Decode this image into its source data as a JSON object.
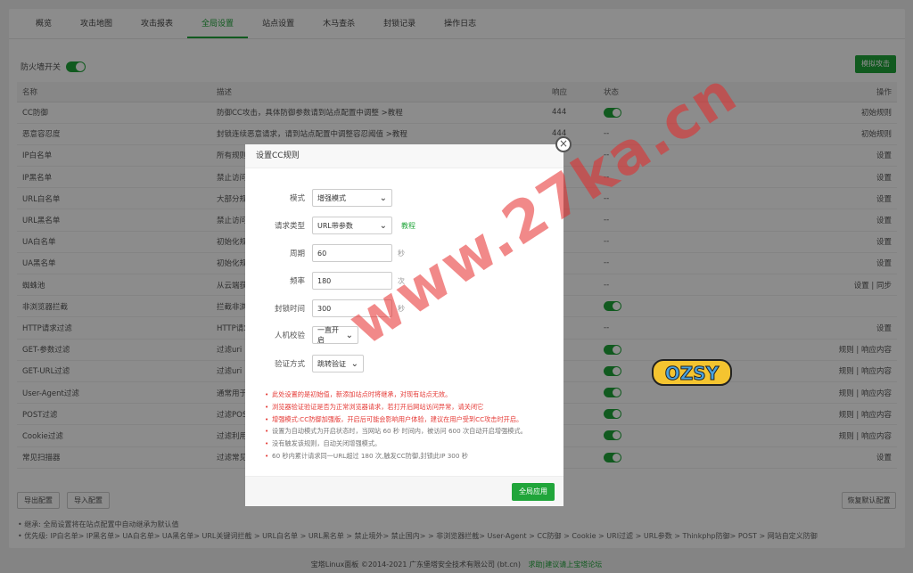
{
  "tabs": [
    "概览",
    "攻击地图",
    "攻击报表",
    "全局设置",
    "站点设置",
    "木马查杀",
    "封锁记录",
    "操作日志"
  ],
  "active_tab": 3,
  "firewall_label": "防火墙开关",
  "simulate_btn": "模拟攻击",
  "table": {
    "headers": [
      "名称",
      "描述",
      "响应",
      "状态",
      "操作"
    ],
    "rows": [
      {
        "name": "CC防御",
        "desc": "防御CC攻击，具体防御参数请到站点配置中调整 >教程",
        "resp": "444",
        "status": "on",
        "op": "初始规则"
      },
      {
        "name": "恶意容忍度",
        "desc": "封锁连续恶意请求，请到站点配置中调整容忍阈值 >教程",
        "resp": "444",
        "status": "--",
        "op": "初始规则"
      },
      {
        "name": "IP白名单",
        "desc": "所有规则",
        "resp": "",
        "status": "--",
        "op": "设置"
      },
      {
        "name": "IP黑名单",
        "desc": "禁止访问",
        "resp": "",
        "status": "--",
        "op": "设置"
      },
      {
        "name": "URL白名单",
        "desc": "大部分规则",
        "resp": "",
        "status": "--",
        "op": "设置"
      },
      {
        "name": "URL黑名单",
        "desc": "禁止访问",
        "resp": "",
        "status": "--",
        "op": "设置"
      },
      {
        "name": "UA白名单",
        "desc": "初始化规则",
        "resp": "",
        "status": "--",
        "op": "设置"
      },
      {
        "name": "UA黑名单",
        "desc": "初始化规则",
        "resp": "",
        "status": "--",
        "op": "设置"
      },
      {
        "name": "蜘蛛池",
        "desc": "从云端获取",
        "resp": "",
        "status": "--",
        "op": "设置 | 同步"
      },
      {
        "name": "非浏览器拦截",
        "desc": "拦截非浏览器",
        "resp": "",
        "status": "on",
        "op": ""
      },
      {
        "name": "HTTP请求过滤",
        "desc": "HTTP请求",
        "resp": "",
        "status": "--",
        "op": "设置"
      },
      {
        "name": "GET-参数过滤",
        "desc": "过滤uri",
        "resp": "",
        "status": "on",
        "op": "规则 | 响应内容"
      },
      {
        "name": "GET-URL过滤",
        "desc": "过滤uri",
        "resp": "",
        "status": "on",
        "op": "规则 | 响应内容"
      },
      {
        "name": "User-Agent过滤",
        "desc": "通常用于",
        "resp": "",
        "status": "on",
        "op": "规则 | 响应内容"
      },
      {
        "name": "POST过滤",
        "desc": "过滤POST",
        "resp": "",
        "status": "on",
        "op": "规则 | 响应内容"
      },
      {
        "name": "Cookie过滤",
        "desc": "过滤利用",
        "resp": "",
        "status": "on",
        "op": "规则 | 响应内容"
      },
      {
        "name": "常见扫描器",
        "desc": "过滤常见",
        "resp": "",
        "status": "on",
        "op": "设置"
      }
    ]
  },
  "export_btn": "导出配置",
  "import_btn": "导入配置",
  "restore_btn": "恢复默认配置",
  "notes": [
    "继承: 全局设置将在站点配置中自动继承为默认值",
    "优先级: IP白名单> IP黑名单> UA白名单> UA黑名单> URL关键词拦截 > URL白名单 > URL黑名单 > 禁止境外> 禁止国内> > 非浏览器拦截> User-Agent > CC防御 > Cookie > URI过滤 > URL参数 > Thinkphp防御> POST > 网站自定义防御"
  ],
  "footer": "宝塔Linux面板 ©2014-2021 广东堡塔安全技术有限公司 (bt.cn)",
  "footer_link": "求助|建议请上宝塔论坛",
  "modal": {
    "title": "设置CC规则",
    "fields": [
      {
        "label": "模式",
        "value": "增强模式",
        "type": "select"
      },
      {
        "label": "请求类型",
        "value": "URL带参数",
        "type": "select",
        "extra": "教程"
      },
      {
        "label": "周期",
        "value": "60",
        "type": "input",
        "unit": "秒"
      },
      {
        "label": "频率",
        "value": "180",
        "type": "input",
        "unit": "次"
      },
      {
        "label": "封锁时间",
        "value": "300",
        "type": "input",
        "unit": "秒"
      },
      {
        "label": "人机校验",
        "value": "一直开启",
        "type": "select"
      },
      {
        "label": "验证方式",
        "value": "跳转验证",
        "type": "select"
      }
    ],
    "tips": [
      "此处设置的是初始值，新添加站点时将继承，对现有站点无效。",
      "浏览器验证验证是否为正常浏览器请求，若打开后网站访问异常，请关闭它",
      "增强模式:CC防御加强版，开启后可能会影响用户体验，建议在用户受到CC攻击时开启。",
      "设置为自动模式为开启状态时，当网站 60 秒 时间内，被访问 600 次自动开启增强模式。",
      "没有触发该规则，自动关闭增强模式。",
      "60 秒内累计请求同一URL超过 180 次,触发CC防御,封锁此IP 300 秒"
    ],
    "apply_btn": "全局应用"
  },
  "watermark": "www.27ka.cn",
  "badge": "OZSY",
  "colors": {
    "accent": "#20a53a",
    "danger": "#e53935"
  }
}
